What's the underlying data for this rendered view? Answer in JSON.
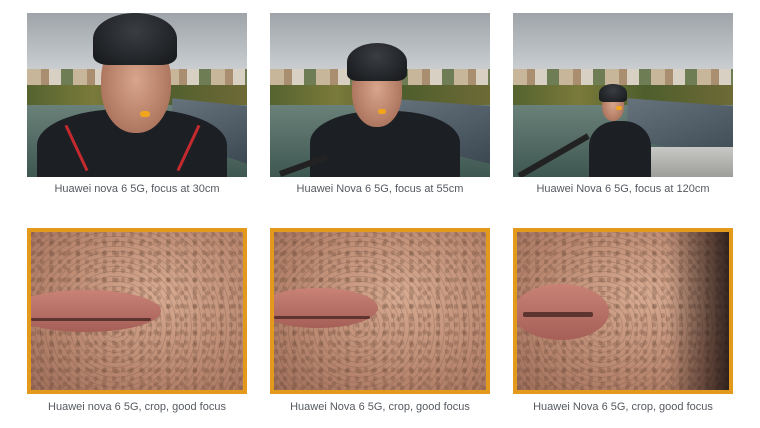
{
  "colors": {
    "crop_border": "#e39a1c",
    "caption": "#555a60",
    "marker": "#f1a51d"
  },
  "gallery": {
    "top": [
      {
        "caption": "Huawei nova 6 5G, focus at 30cm"
      },
      {
        "caption": "Huawei Nova 6 5G, focus at 55cm"
      },
      {
        "caption": "Huawei Nova 6 5G, focus at 120cm"
      }
    ],
    "bottom": [
      {
        "caption": "Huawei nova 6 5G, crop, good focus"
      },
      {
        "caption": "Huawei Nova 6 5G, crop, good focus"
      },
      {
        "caption": "Huawei Nova 6 5G, crop, good focus"
      }
    ]
  }
}
